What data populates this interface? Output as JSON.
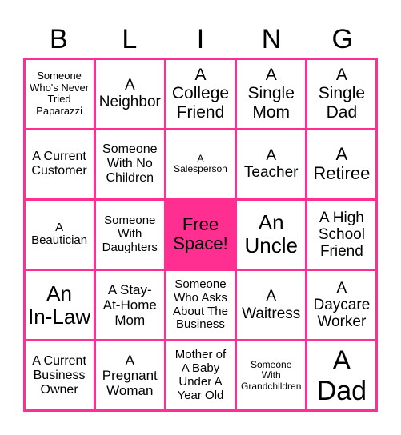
{
  "header": {
    "letters": [
      "B",
      "L",
      "I",
      "N",
      "G"
    ]
  },
  "colors": {
    "grid": "#ff2f92",
    "free_space": "#ff2f92"
  },
  "cells": [
    "Someone\nWho's Never\nTried\nPaparazzi",
    "A\nNeighbor",
    "A\nCollege\nFriend",
    "A\nSingle\nMom",
    "A\nSingle\nDad",
    "A Current\nCustomer",
    "Someone\nWith No\nChildren",
    "A\nSalesperson",
    "A\nTeacher",
    "A\nRetiree",
    "A\nBeautician",
    "Someone\nWith\nDaughters",
    "Free\nSpace!",
    "An\nUncle",
    "A High\nSchool\nFriend",
    "An\nIn-Law",
    "A Stay-\nAt-Home\nMom",
    "Someone\nWho Asks\nAbout The\nBusiness",
    "A\nWaitress",
    "A\nDaycare\nWorker",
    "A Current\nBusiness\nOwner",
    "A\nPregnant\nWoman",
    "Mother of\nA Baby\nUnder A\nYear Old",
    "Someone\nWith\nGrandchildren",
    "A\nDad"
  ]
}
